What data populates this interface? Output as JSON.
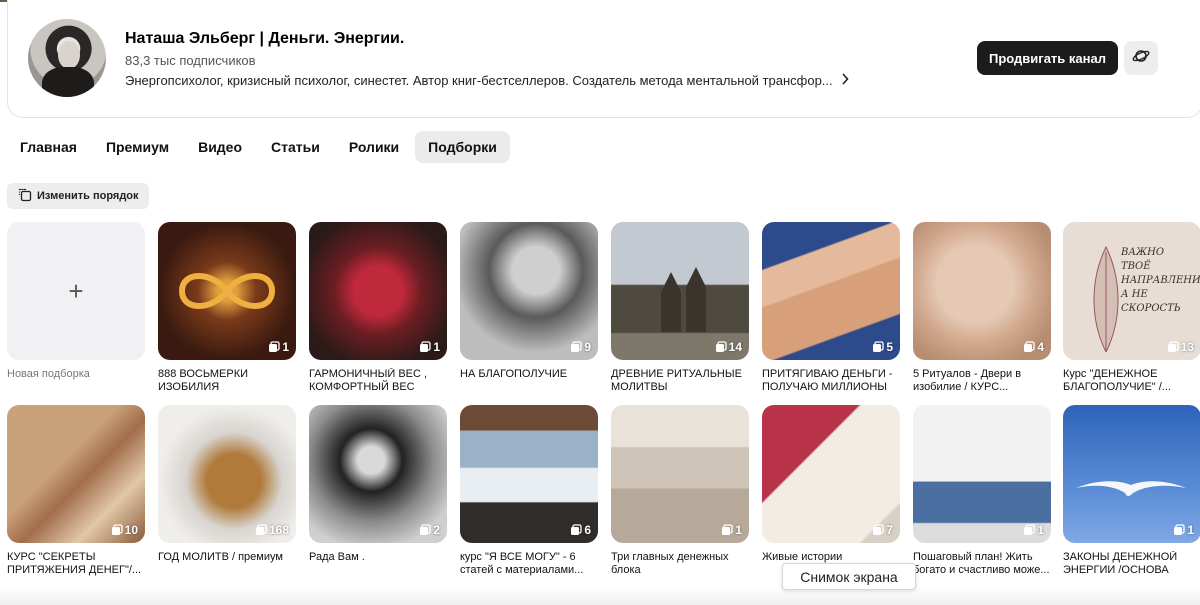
{
  "channel": {
    "title": "Наташа Эльберг | Деньги. Энергии.",
    "subscribers": "83,3 тыс подписчиков",
    "description": "Энергопсихолог, кризисный психолог, синестет. Автор книг-бестселлеров. Создатель метода ментальной трансфор...",
    "promote_label": "Продвигать канал"
  },
  "tabs": [
    {
      "label": "Главная",
      "active": false
    },
    {
      "label": "Премиум",
      "active": false
    },
    {
      "label": "Видео",
      "active": false
    },
    {
      "label": "Статьи",
      "active": false
    },
    {
      "label": "Ролики",
      "active": false
    },
    {
      "label": "Подборки",
      "active": true
    }
  ],
  "reorder_label": "Изменить порядок",
  "new_collection": {
    "plus": "+",
    "label": "Новая подборка"
  },
  "collections_row1": [
    {
      "title": "888 ВОСЬМЕРКИ ИЗОБИЛИЯ",
      "count": "1"
    },
    {
      "title": "ГАРМОНИЧНЫЙ ВЕС , КОМФОРТНЫЙ ВЕС",
      "count": "1"
    },
    {
      "title": "НА БЛАГОПОЛУЧИЕ",
      "count": "9"
    },
    {
      "title": "ДРЕВНИЕ РИТУАЛЬНЫЕ МОЛИТВЫ",
      "count": "14"
    },
    {
      "title": "ПРИТЯГИВАЮ ДЕНЬГИ - ПОЛУЧАЮ МИЛЛИОНЫ",
      "count": "5"
    },
    {
      "title": "5 Ритуалов - Двери в изобилие / КУРС...",
      "count": "4"
    },
    {
      "title": "Курс \"ДЕНЕЖНОЕ БЛАГОПОЛУЧИЕ\" /...",
      "count": "13"
    }
  ],
  "card7_text": "ВАЖНО ТВОЁ НАПРАВЛЕНИЕ, А НЕ СКОРОСТЬ",
  "collections_row2": [
    {
      "title": "КУРС \"СЕКРЕТЫ ПРИТЯЖЕНИЯ ДЕНЕГ\"/...",
      "count": "10"
    },
    {
      "title": "ГОД МОЛИТВ / премиум",
      "count": "168"
    },
    {
      "title": "Рада Вам .",
      "count": "2"
    },
    {
      "title": "курс \"Я ВСЕ МОГУ\" - 6 статей с материалами...",
      "count": "6"
    },
    {
      "title": "Три главных денежных блока",
      "count": "1"
    },
    {
      "title": "Живые истории",
      "count": "7"
    },
    {
      "title": "Пошаговый план! Жить богато и счастливо може...",
      "count": "1"
    },
    {
      "title": "ЗАКОНЫ ДЕНЕЖНОЙ ЭНЕРГИИ /ОСНОВА",
      "count": "1"
    }
  ],
  "tooltip": "Снимок экрана",
  "icons": {
    "planet": "planet-icon",
    "reorder": "reorder-icon",
    "collection_count": "stack-icon",
    "chevron": "chevron-right-icon"
  }
}
